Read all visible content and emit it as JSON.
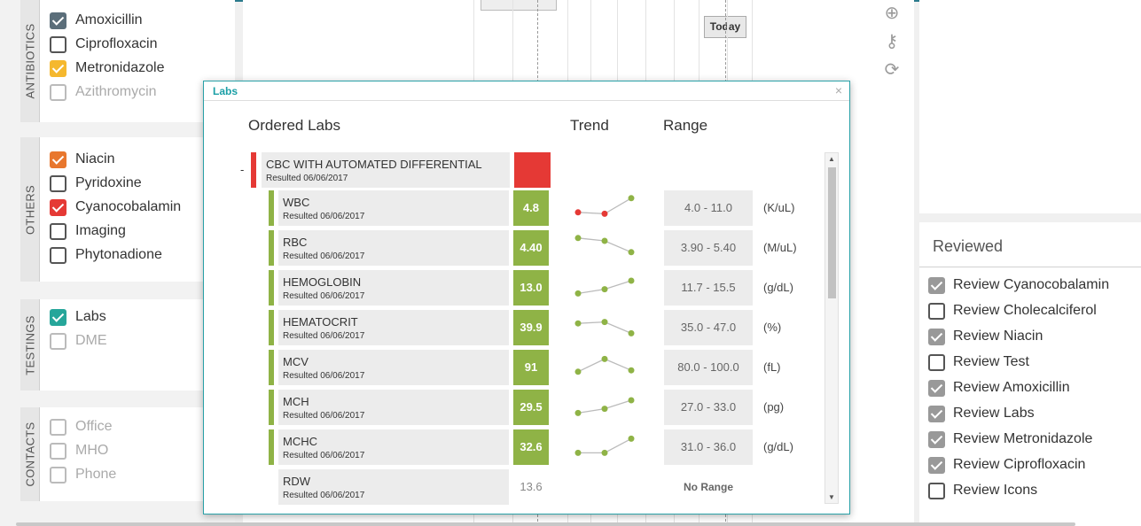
{
  "groups": [
    {
      "tab": "ANTIBIOTICS",
      "items": [
        {
          "label": "Amoxicillin",
          "state": "checked",
          "color": "#5b6e7a"
        },
        {
          "label": "Ciprofloxacin",
          "state": "unchecked"
        },
        {
          "label": "Metronidazole",
          "state": "checked",
          "color": "#f5b82e"
        },
        {
          "label": "Azithromycin",
          "state": "disabled"
        }
      ]
    },
    {
      "tab": "OTHERS",
      "items": [
        {
          "label": "Niacin",
          "state": "checked",
          "color": "#e8772e"
        },
        {
          "label": "Pyridoxine",
          "state": "unchecked"
        },
        {
          "label": "Cyanocobalamin",
          "state": "checked",
          "color": "#e53935"
        },
        {
          "label": "Imaging",
          "state": "unchecked"
        },
        {
          "label": "Phytonadione",
          "state": "unchecked"
        }
      ]
    },
    {
      "tab": "TESTINGS",
      "items": [
        {
          "label": "Labs",
          "state": "checked",
          "color": "#26a69a"
        },
        {
          "label": "DME",
          "state": "disabled"
        }
      ]
    },
    {
      "tab": "CONTACTS",
      "items": [
        {
          "label": "Office",
          "state": "disabled"
        },
        {
          "label": "MHO",
          "state": "disabled"
        },
        {
          "label": "Phone",
          "state": "disabled"
        }
      ]
    }
  ],
  "timeline": {
    "today_label": "Today",
    "tools": [
      "zoom-in-icon",
      "key-icon",
      "refresh-icon"
    ]
  },
  "modal": {
    "title": "Labs",
    "close": "×",
    "headers": {
      "ordered": "Ordered Labs",
      "trend": "Trend",
      "range": "Range"
    },
    "collapse": "-",
    "parent": {
      "name": "CBC WITH AUTOMATED DIFFERENTIAL",
      "resulted": "Resulted 06/06/2017",
      "flag_color": "#e53935"
    },
    "labs": [
      {
        "name": "WBC",
        "resulted": "Resulted 06/06/2017",
        "value": "4.8",
        "range": "4.0 - 11.0",
        "unit": "(K/uL)",
        "trend": [
          0.35,
          0.3,
          0.85
        ],
        "trend_colors": [
          "#e53935",
          "#e53935",
          "#8fb346"
        ],
        "boxed": true
      },
      {
        "name": "RBC",
        "resulted": "Resulted 06/06/2017",
        "value": "4.40",
        "range": "3.90 - 5.40",
        "unit": "(M/uL)",
        "trend": [
          0.85,
          0.75,
          0.35
        ],
        "trend_colors": [
          "#8fb346",
          "#8fb346",
          "#8fb346"
        ],
        "boxed": true
      },
      {
        "name": "HEMOGLOBIN",
        "resulted": "Resulted 06/06/2017",
        "value": "13.0",
        "range": "11.7 - 15.5",
        "unit": "(g/dL)",
        "trend": [
          0.3,
          0.45,
          0.75
        ],
        "trend_colors": [
          "#8fb346",
          "#8fb346",
          "#8fb346"
        ],
        "boxed": true
      },
      {
        "name": "HEMATOCRIT",
        "resulted": "Resulted 06/06/2017",
        "value": "39.9",
        "range": "35.0 - 47.0",
        "unit": "(%)",
        "trend": [
          0.65,
          0.7,
          0.3
        ],
        "trend_colors": [
          "#8fb346",
          "#8fb346",
          "#8fb346"
        ],
        "boxed": true
      },
      {
        "name": "MCV",
        "resulted": "Resulted 06/06/2017",
        "value": "91",
        "range": "80.0 - 100.0",
        "unit": "(fL)",
        "trend": [
          0.35,
          0.8,
          0.4
        ],
        "trend_colors": [
          "#8fb346",
          "#8fb346",
          "#8fb346"
        ],
        "boxed": true
      },
      {
        "name": "MCH",
        "resulted": "Resulted 06/06/2017",
        "value": "29.5",
        "range": "27.0 - 33.0",
        "unit": "(pg)",
        "trend": [
          0.3,
          0.45,
          0.75
        ],
        "trend_colors": [
          "#8fb346",
          "#8fb346",
          "#8fb346"
        ],
        "boxed": true
      },
      {
        "name": "MCHC",
        "resulted": "Resulted 06/06/2017",
        "value": "32.6",
        "range": "31.0 - 36.0",
        "unit": "(g/dL)",
        "trend": [
          0.3,
          0.3,
          0.8
        ],
        "trend_colors": [
          "#8fb346",
          "#8fb346",
          "#8fb346"
        ],
        "boxed": true
      },
      {
        "name": "RDW",
        "resulted": "Resulted 06/06/2017",
        "value": "13.6",
        "range": "No Range",
        "unit": "",
        "trend": [],
        "trend_colors": [],
        "boxed": false
      }
    ]
  },
  "reviewed": {
    "title": "Reviewed",
    "items": [
      {
        "label": "Review Cyanocobalamin",
        "checked": true
      },
      {
        "label": "Review Cholecalciferol",
        "checked": false
      },
      {
        "label": "Review Niacin",
        "checked": true
      },
      {
        "label": "Review Test",
        "checked": false
      },
      {
        "label": "Review Amoxicillin",
        "checked": true
      },
      {
        "label": "Review Labs",
        "checked": true
      },
      {
        "label": "Review Metronidazole",
        "checked": true
      },
      {
        "label": "Review Ciprofloxacin",
        "checked": true
      },
      {
        "label": "Review Icons",
        "checked": false
      }
    ]
  }
}
